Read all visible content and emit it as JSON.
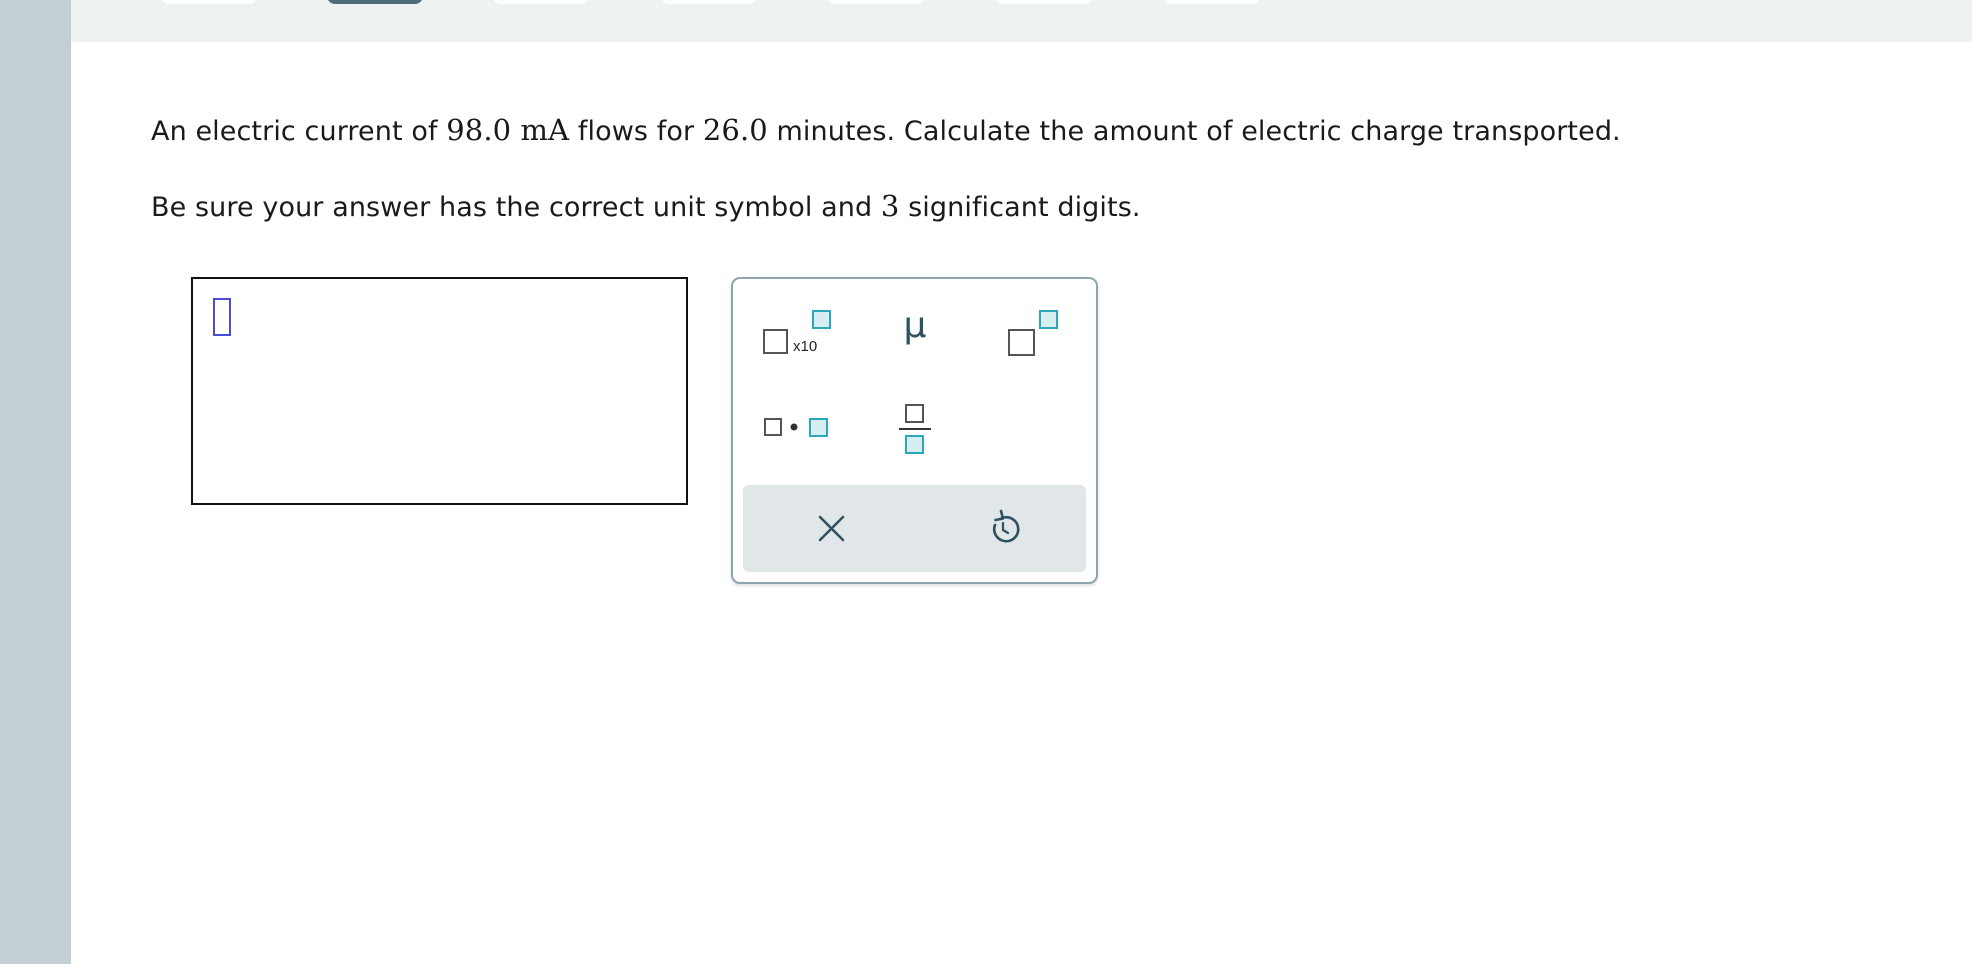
{
  "question": {
    "pre": "An electric current of ",
    "current": "98.0 mA",
    "mid": " flows for ",
    "time": "26.0",
    "post": " minutes. Calculate the amount of electric charge transported."
  },
  "instructions": {
    "pre": "Be sure your answer has the correct unit symbol and ",
    "digits": "3",
    "post": " significant digits."
  },
  "answer": {
    "value": ""
  },
  "palette": {
    "x10_label": "x10",
    "mu_label": "μ",
    "icons": [
      "times-ten-power-icon",
      "mu-prefix-icon",
      "superscript-icon",
      "multiply-dot-icon",
      "fraction-icon",
      "clear-icon",
      "undo-icon"
    ]
  },
  "colors": {
    "rail": "#c3cfd4",
    "topband": "#eff2f3",
    "accent_teal": "#2aa8b8",
    "accent_fill": "#d6eef1",
    "cursor_blue": "#4a4bd9",
    "icon_dark": "#2f5160"
  }
}
